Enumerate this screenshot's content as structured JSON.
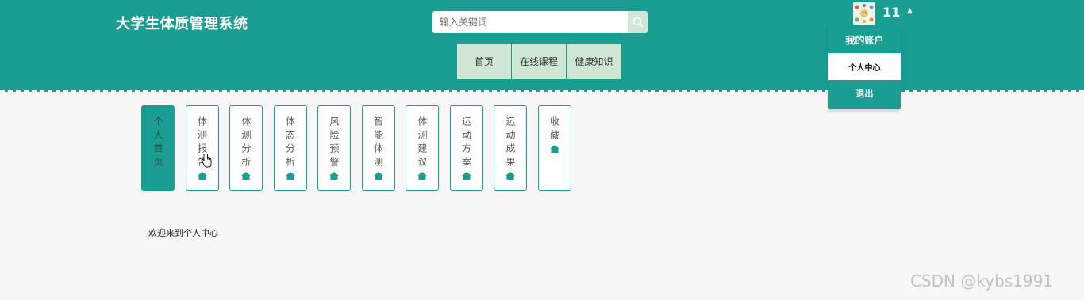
{
  "header": {
    "site_title": "大学生体质管理系统",
    "search_placeholder": "输入关键词",
    "bg_color": "#1a9e92"
  },
  "nav": {
    "items": [
      {
        "label": "首页"
      },
      {
        "label": "在线课程"
      },
      {
        "label": "健康知识"
      }
    ]
  },
  "user": {
    "name": "11",
    "dropdown": {
      "title": "我的账户",
      "items": [
        {
          "label": "个人中心",
          "active": true
        },
        {
          "label": "退出",
          "active": false
        }
      ]
    }
  },
  "side_menu": {
    "items": [
      {
        "label": "个人首页",
        "active": true,
        "icon": "home-icon"
      },
      {
        "label": "体测报告",
        "active": false,
        "icon": "home-icon"
      },
      {
        "label": "体测分析",
        "active": false,
        "icon": "home-icon"
      },
      {
        "label": "体态分析",
        "active": false,
        "icon": "home-icon"
      },
      {
        "label": "风险预警",
        "active": false,
        "icon": "home-icon"
      },
      {
        "label": "智能体测",
        "active": false,
        "icon": "home-icon"
      },
      {
        "label": "体测建议",
        "active": false,
        "icon": "home-icon"
      },
      {
        "label": "运动方案",
        "active": false,
        "icon": "home-icon"
      },
      {
        "label": "运动成果",
        "active": false,
        "icon": "home-icon"
      },
      {
        "label": "收藏",
        "active": false,
        "icon": "home-icon"
      }
    ]
  },
  "content": {
    "welcome_text": "欢迎来到个人中心"
  },
  "watermark": "CSDN @kybs1991"
}
